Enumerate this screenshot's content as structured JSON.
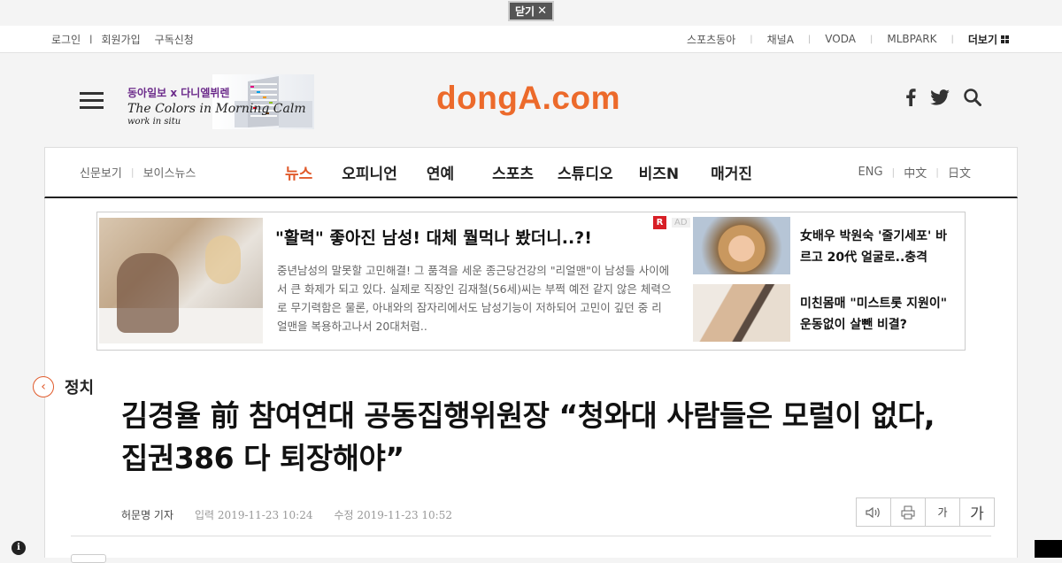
{
  "close_bar": {
    "label": "닫기",
    "icon": "close-icon"
  },
  "util_left": [
    "로그인",
    "회원가입",
    "구독신청"
  ],
  "util_right": [
    "스포츠동아",
    "채널A",
    "VODA",
    "MLBPARK"
  ],
  "util_more": "더보기",
  "promo": {
    "line1": "동아일보 x 다니엘뷔렌",
    "line2": "The Colors in Morning Calm",
    "line3": "work in situ"
  },
  "brand": "dongA.com",
  "header_icons": [
    "facebook-icon",
    "twitter-icon",
    "search-icon"
  ],
  "nav_left": [
    "신문보기",
    "보이스뉴스"
  ],
  "nav_main": [
    "뉴스",
    "오피니언",
    "연예",
    "스포츠",
    "스튜디오",
    "비즈N",
    "매거진"
  ],
  "nav_active_index": 0,
  "nav_right": [
    "ENG",
    "中文",
    "日文"
  ],
  "colors": {
    "accent": "#ec6a2b",
    "nav_active": "#e05a2b",
    "ad_mark": "#d81f26"
  },
  "ad": {
    "title": "\"활력\" 좋아진 남성! 대체 뭘먹나 봤더니..?!",
    "body": "중년남성의 말못할 고민해결! 그 품격을 세운 종근당건강의 \"리얼맨\"이 남성들 사이에서 큰 화제가 되고 있다. 실제로 직장인 김재철(56세)씨는 부쩍 예전 같지 않은 체력으로 무기력함은 물론, 아내와의 잠자리에서도 남성기능이 저하되어 고민이 깊던 중 리얼맨을 복용하고나서 20대처럼..",
    "mark": "R",
    "label": "AD",
    "side": [
      {
        "text": "女배우 박원숙 '줄기세포' 바르고 20代 얼굴로..충격"
      },
      {
        "text": "미친몸매 \"미스트롯 지원이\" 운동없이 살뺀 비결?"
      }
    ]
  },
  "category": {
    "arrow": "‹",
    "label": "정치"
  },
  "headline": "김경율 前 참여연대 공동집행위원장 “청와대 사람들은 모럴이 없다, 집권386 다 퇴장해야”",
  "byline": {
    "author": "허문명 기자",
    "published": "입력 2019-11-23 10:24",
    "modified": "수정 2019-11-23 10:52"
  },
  "tools": [
    {
      "icon": "speaker-icon",
      "label": ""
    },
    {
      "icon": "print-icon",
      "label": ""
    },
    {
      "icon": "font-smaller-icon",
      "label": "가"
    },
    {
      "icon": "font-larger-icon",
      "label": "가"
    }
  ],
  "info_badge": "i"
}
